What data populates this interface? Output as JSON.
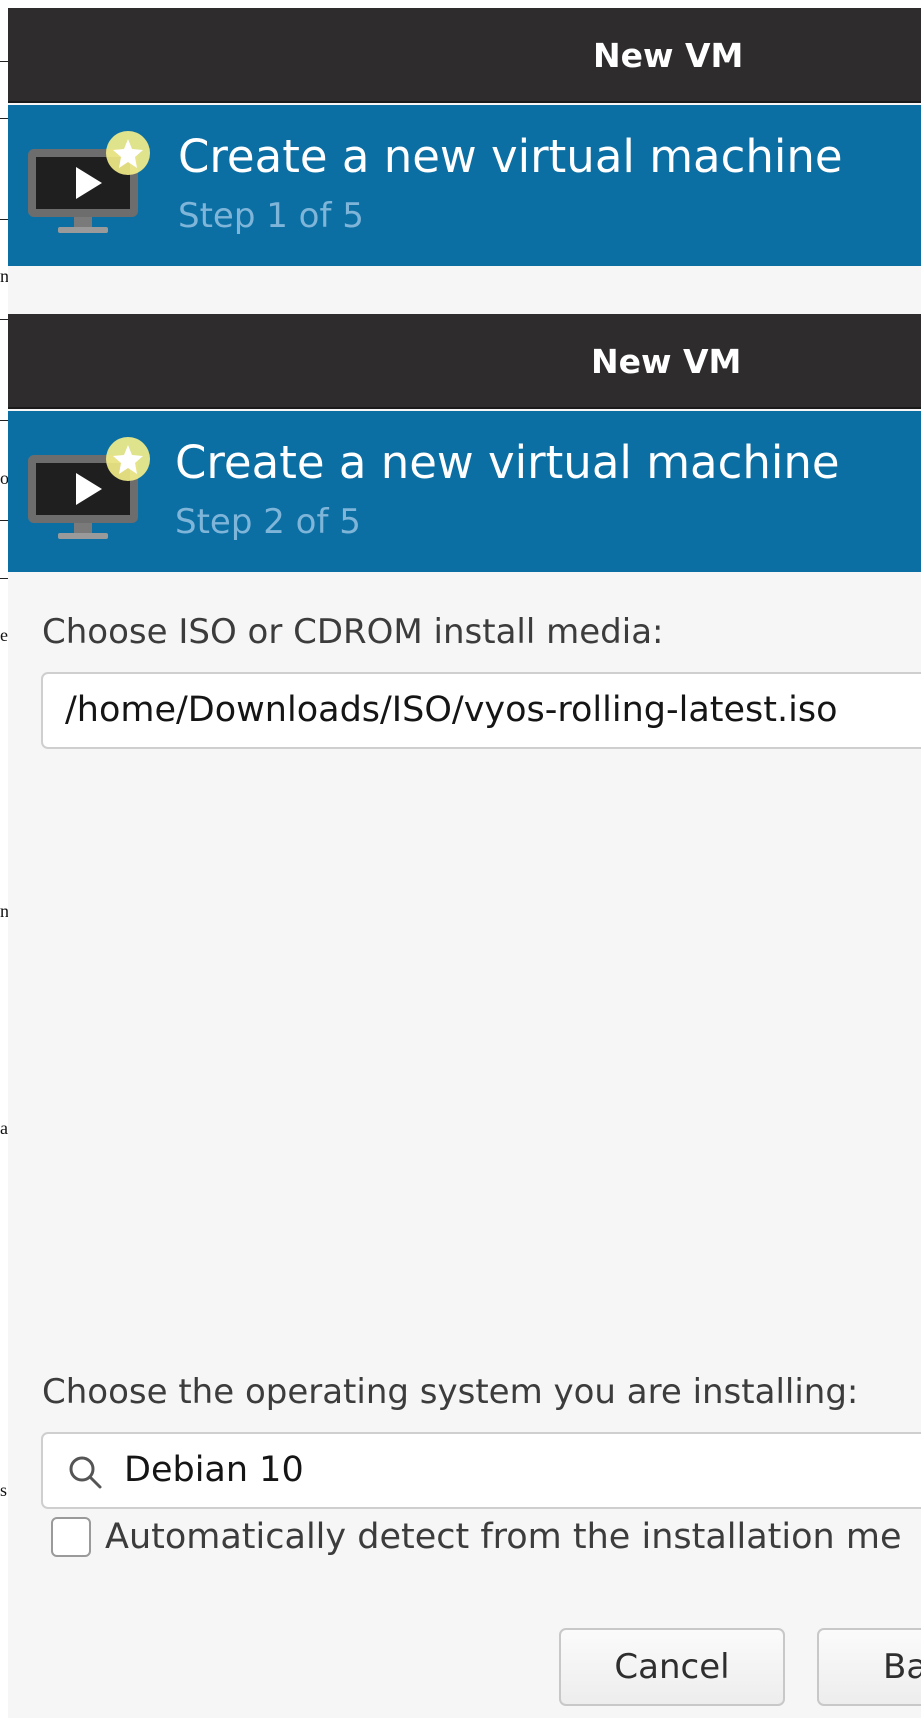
{
  "background_fragments": [
    "n",
    "o",
    "e",
    "n",
    "a",
    "s"
  ],
  "window1": {
    "title": "New VM",
    "banner": {
      "icon": "monitor-play-star-icon",
      "title": "Create a new virtual machine",
      "step": "Step 1 of 5"
    }
  },
  "window2": {
    "title": "New VM",
    "banner": {
      "icon": "monitor-play-star-icon",
      "title": "Create a new virtual machine",
      "step": "Step 2 of 5"
    },
    "install_media": {
      "label": "Choose ISO or CDROM install media:",
      "value": "/home/Downloads/ISO/vyos-rolling-latest.iso"
    },
    "os": {
      "label": "Choose the operating system you are installing:",
      "search_icon": "search-icon",
      "value": "Debian 10"
    },
    "auto_detect": {
      "checked": false,
      "label": "Automatically detect from the installation me"
    },
    "buttons": {
      "cancel": "Cancel",
      "back": "Ba"
    }
  },
  "colors": {
    "titlebar": "#2e2c2d",
    "banner": "#0b6fa4",
    "step_text": "#7fb5d8",
    "window_bg": "#f6f6f6"
  }
}
